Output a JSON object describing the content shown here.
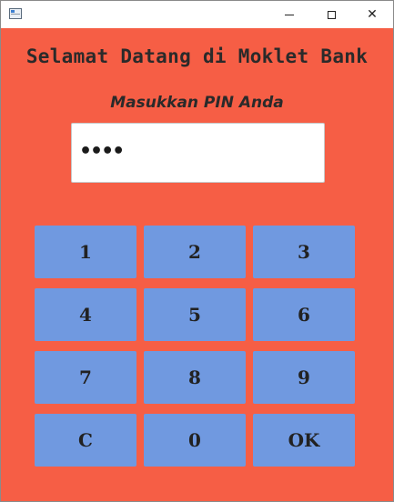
{
  "window": {
    "app_icon": "window-app-icon",
    "controls": {
      "minimize_icon": "minimize-icon",
      "maximize_icon": "maximize-icon",
      "close_icon": "close-icon",
      "close_glyph": "✕"
    }
  },
  "header": {
    "title": "Selamat Datang di Moklet Bank",
    "subtitle": "Masukkan PIN Anda"
  },
  "pin": {
    "masked_value": "••••",
    "digits_entered": 4
  },
  "keypad": {
    "keys": [
      "1",
      "2",
      "3",
      "4",
      "5",
      "6",
      "7",
      "8",
      "9",
      "C",
      "0",
      "OK"
    ]
  },
  "colors": {
    "background": "#f65e45",
    "key": "#7099e0",
    "text": "#2a2a2a",
    "field": "#ffffff"
  }
}
